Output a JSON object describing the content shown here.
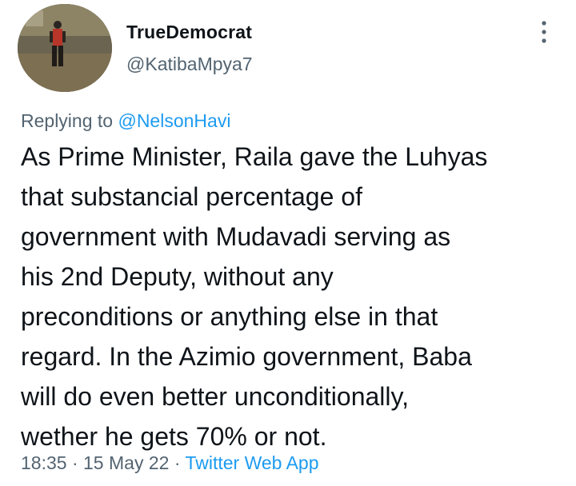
{
  "author": {
    "display_name": "TrueDemocrat",
    "handle": "@KatibaMpya7"
  },
  "reply": {
    "prefix": "Replying to",
    "mention": "@NelsonHavi"
  },
  "tweet": {
    "lines": [
      "As Prime Minister, Raila gave the Luhyas",
      "that substancial percentage of",
      "government with Mudavadi serving as",
      "his 2nd Deputy, without any",
      "preconditions or anything else in that",
      "regard. In the Azimio government, Baba",
      "will do even better unconditionally,",
      "wether he gets 70% or not."
    ]
  },
  "meta": {
    "time": "18:35",
    "separator": "·",
    "date": "15 May 22",
    "source": "Twitter Web App"
  },
  "icons": {
    "more": "more-vertical-icon"
  },
  "colors": {
    "text": "#0f1419",
    "secondary": "#536471",
    "link": "#1d9bf0"
  }
}
